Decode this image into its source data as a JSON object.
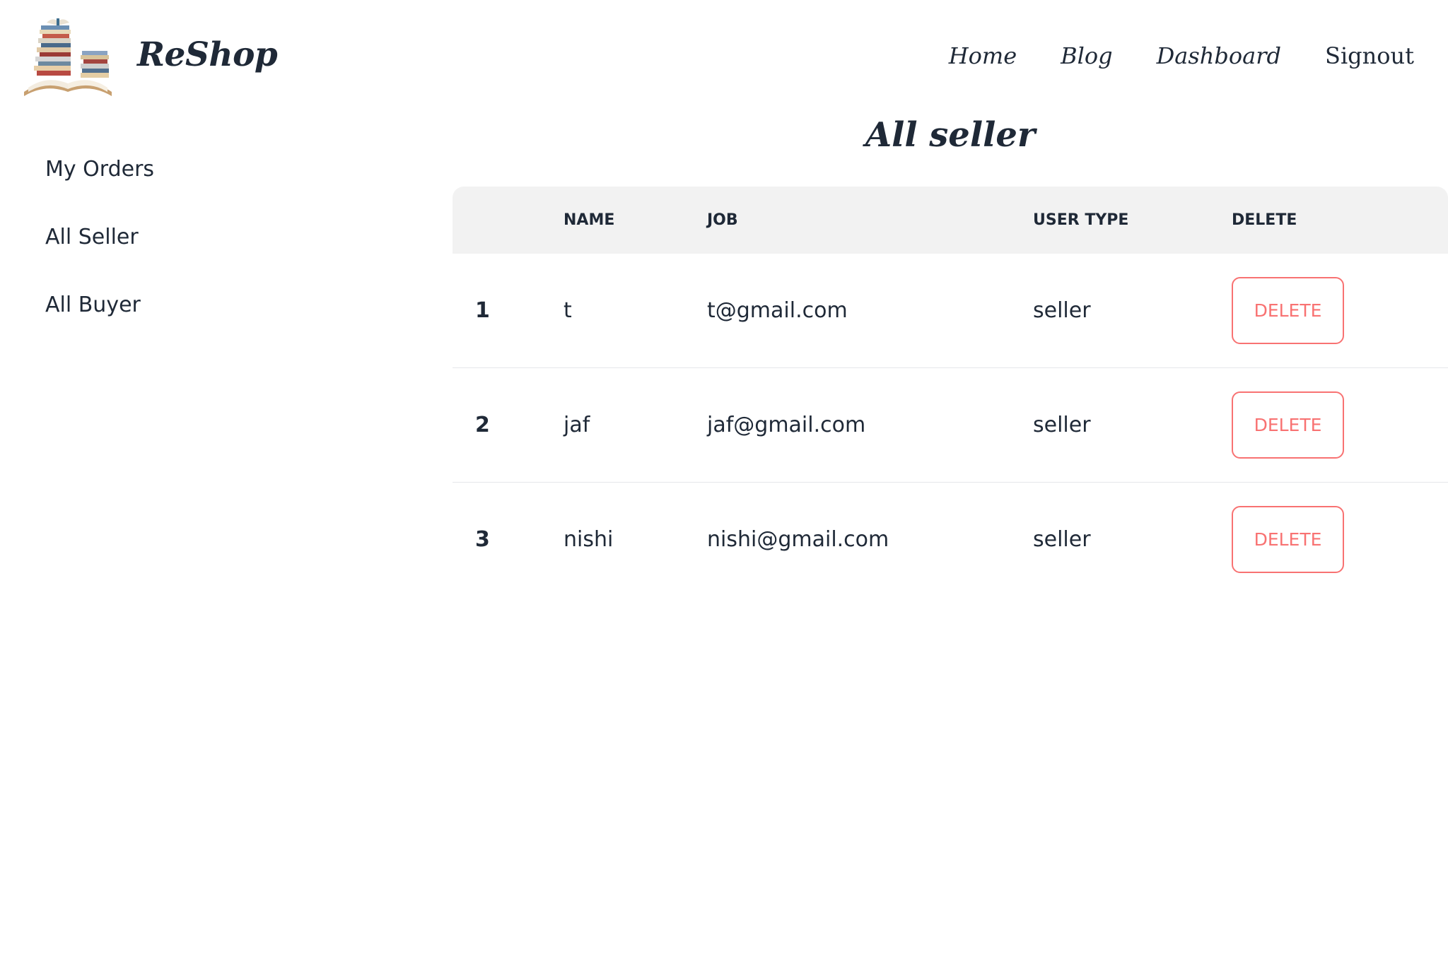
{
  "header": {
    "brand": "ReShop",
    "nav": [
      "Home",
      "Blog",
      "Dashboard",
      "Signout"
    ]
  },
  "sidebar": {
    "items": [
      "My Orders",
      "All Seller",
      "All Buyer"
    ]
  },
  "main": {
    "title": "All seller",
    "table": {
      "columns": [
        "",
        "NAME",
        "JOB",
        "USER TYPE",
        "DELETE"
      ],
      "rows": [
        {
          "index": "1",
          "name": "t",
          "job": "t@gmail.com",
          "type": "seller",
          "action": "DELETE"
        },
        {
          "index": "2",
          "name": "jaf",
          "job": "jaf@gmail.com",
          "type": "seller",
          "action": "DELETE"
        },
        {
          "index": "3",
          "name": "nishi",
          "job": "nishi@gmail.com",
          "type": "seller",
          "action": "DELETE"
        }
      ]
    }
  },
  "colors": {
    "text": "#1f2937",
    "header_bg": "#f2f2f2",
    "delete_accent": "#f87272"
  },
  "icons": {
    "logo": "books-stack-icon"
  }
}
